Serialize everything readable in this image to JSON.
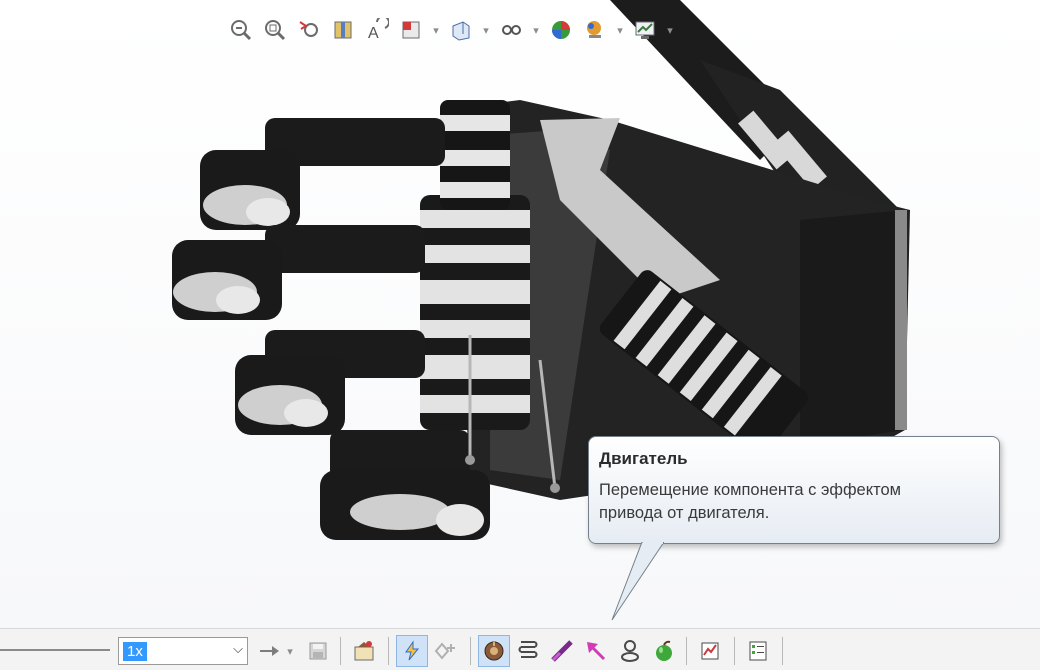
{
  "viewport": {
    "heads_up_toolbar": [
      {
        "name": "zoom-to-fit-icon"
      },
      {
        "name": "zoom-to-area-icon"
      },
      {
        "name": "previous-view-icon"
      },
      {
        "name": "section-view-icon"
      },
      {
        "name": "dynamic-annotation-icon"
      },
      {
        "name": "view-orientation-icon",
        "dropdown": true
      },
      {
        "name": "display-style-icon",
        "dropdown": true
      },
      {
        "name": "hide-show-items-icon",
        "dropdown": true
      },
      {
        "name": "edit-appearance-icon"
      },
      {
        "name": "apply-scene-icon",
        "dropdown": true
      },
      {
        "name": "view-settings-icon",
        "dropdown": true
      }
    ],
    "dropdown_glyph": "▾",
    "model": {
      "description_icon": "robotic-hand-model"
    }
  },
  "tooltip": {
    "title": "Двигатель",
    "description": "Перемещение компонента с эффектом привода от двигателя."
  },
  "motion_toolbar": {
    "playback_speed": "1x",
    "speed_caret": "⌵",
    "items": [
      {
        "name": "playback-mode-icon",
        "dropdown": true
      },
      {
        "name": "save-animation-icon"
      },
      {
        "name": "animation-wizard-icon"
      },
      {
        "name": "autokey-icon",
        "active": true
      },
      {
        "name": "add-key-icon"
      },
      {
        "name": "motor-icon",
        "active": true
      },
      {
        "name": "spring-icon"
      },
      {
        "name": "damper-icon"
      },
      {
        "name": "force-icon"
      },
      {
        "name": "contact-icon"
      },
      {
        "name": "gravity-icon"
      },
      {
        "name": "results-and-plots-icon"
      },
      {
        "name": "motion-study-properties-icon"
      }
    ]
  },
  "colors": {
    "accent_selection": "#3399ff",
    "tooltip_border": "#76808c",
    "toolbar_active": "#cfe2f7"
  }
}
